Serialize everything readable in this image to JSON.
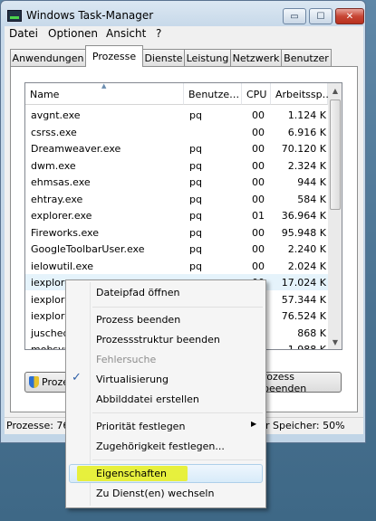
{
  "window": {
    "title": "Windows Task-Manager",
    "buttons": {
      "minimize": "▭",
      "maximize": "☐",
      "close": "✕"
    }
  },
  "menubar": [
    "Datei",
    "Optionen",
    "Ansicht",
    "?"
  ],
  "tabs": [
    "Anwendungen",
    "Prozesse",
    "Dienste",
    "Leistung",
    "Netzwerk",
    "Benutzer"
  ],
  "active_tab": "Prozesse",
  "table": {
    "columns": [
      "Name",
      "Benutze…",
      "CPU",
      "Arbeitssp…"
    ],
    "sort_indicator": "▲",
    "rows": [
      {
        "name": "avgnt.exe",
        "user": "pq",
        "cpu": "00",
        "mem": "1.124 K"
      },
      {
        "name": "csrss.exe",
        "user": "",
        "cpu": "00",
        "mem": "6.916 K"
      },
      {
        "name": "Dreamweaver.exe",
        "user": "pq",
        "cpu": "00",
        "mem": "70.120 K"
      },
      {
        "name": "dwm.exe",
        "user": "pq",
        "cpu": "00",
        "mem": "2.324 K"
      },
      {
        "name": "ehmsas.exe",
        "user": "pq",
        "cpu": "00",
        "mem": "944 K"
      },
      {
        "name": "ehtray.exe",
        "user": "pq",
        "cpu": "00",
        "mem": "584 K"
      },
      {
        "name": "explorer.exe",
        "user": "pq",
        "cpu": "01",
        "mem": "36.964 K"
      },
      {
        "name": "Fireworks.exe",
        "user": "pq",
        "cpu": "00",
        "mem": "95.948 K"
      },
      {
        "name": "GoogleToolbarUser.exe",
        "user": "pq",
        "cpu": "00",
        "mem": "2.240 K"
      },
      {
        "name": "ielowutil.exe",
        "user": "pq",
        "cpu": "00",
        "mem": "2.024 K"
      },
      {
        "name": "iexplore.exe",
        "user": "pq",
        "cpu": "00",
        "mem": "17.024 K"
      },
      {
        "name": "iexplore",
        "user": "",
        "cpu": "",
        "mem": "57.344 K"
      },
      {
        "name": "iexplore",
        "user": "",
        "cpu": "",
        "mem": "76.524 K"
      },
      {
        "name": "jusched",
        "user": "",
        "cpu": "",
        "mem": "868 K"
      },
      {
        "name": "mobsync",
        "user": "",
        "cpu": "",
        "mem": "1.988 K"
      }
    ],
    "selected_row": 10
  },
  "buttons": {
    "show_all": "Proze",
    "end_process": "rozess beenden"
  },
  "status": {
    "processes": "Prozesse: 76",
    "memory": "r Speicher: 50%"
  },
  "context_menu": {
    "items": [
      {
        "label": "Dateipfad öffnen"
      },
      {
        "label": "Prozess beenden"
      },
      {
        "label": "Prozessstruktur beenden"
      },
      {
        "label": "Fehlersuche",
        "disabled": true
      },
      {
        "label": "Virtualisierung",
        "checked": true
      },
      {
        "label": "Abbilddatei erstellen"
      },
      {
        "label": "Priorität festlegen",
        "submenu": true
      },
      {
        "label": "Zugehörigkeit festlegen..."
      },
      {
        "label": "Eigenschaften",
        "highlighted": true
      },
      {
        "label": "Zu Dienst(en) wechseln"
      }
    ],
    "check_glyph": "✓",
    "submenu_glyph": "▶"
  },
  "colors": {
    "highlighter": "#e7ef33",
    "selection": "#e5f3fb"
  }
}
